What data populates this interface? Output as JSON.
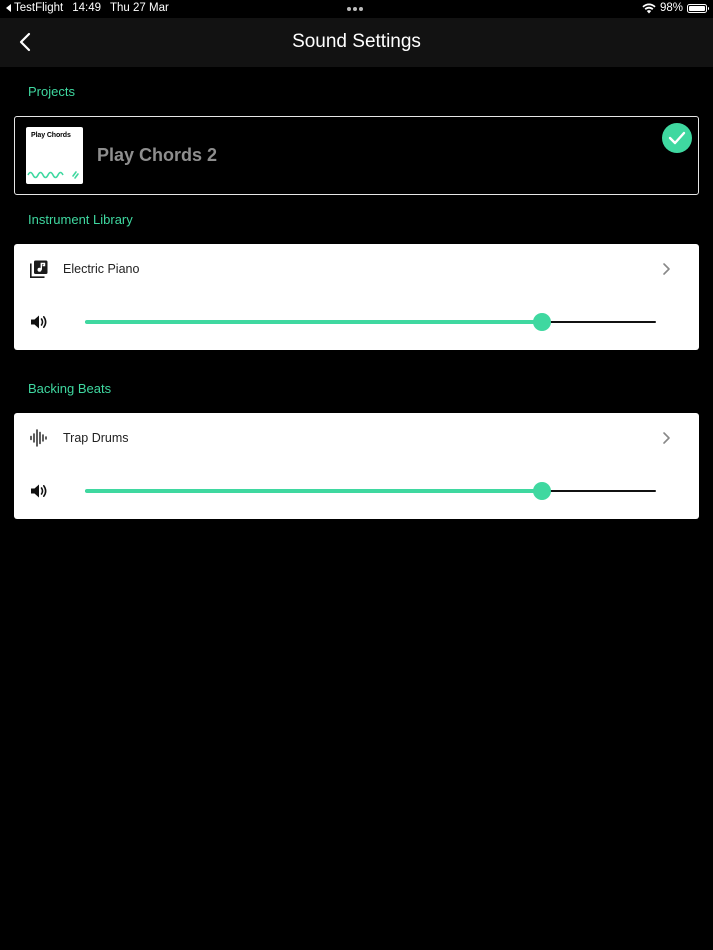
{
  "status_bar": {
    "back_app": "TestFlight",
    "time": "14:49",
    "date": "Thu 27 Mar",
    "battery": "98%",
    "battery_level": 0.98
  },
  "nav": {
    "title": "Sound Settings",
    "back_icon": "chevron-left-icon"
  },
  "projects": {
    "section_label": "Projects",
    "card": {
      "thumbnail_title": "Play Chords",
      "name": "Play Chords 2",
      "selected": true
    }
  },
  "instrument_library": {
    "section_label": "Instrument Library",
    "item": {
      "icon": "music-library-icon",
      "label": "Electric Piano",
      "volume": 0.8
    }
  },
  "backing_beats": {
    "section_label": "Backing Beats",
    "item": {
      "icon": "waveform-icon",
      "label": "Trap Drums",
      "volume": 0.8
    }
  },
  "colors": {
    "accent": "#3fd8a0",
    "background": "#000000",
    "nav_background": "#121212",
    "card_background": "#ffffff"
  }
}
